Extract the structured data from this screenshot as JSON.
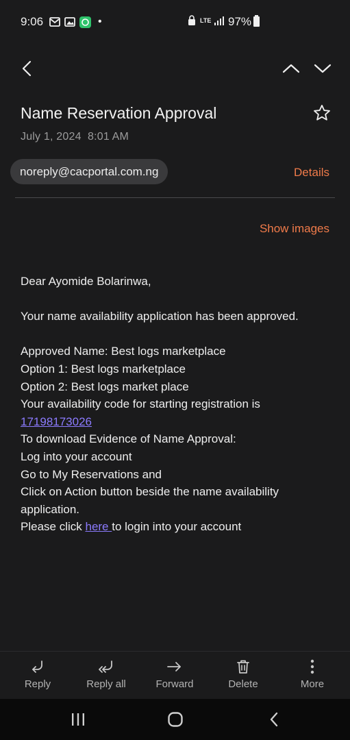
{
  "status_bar": {
    "time": "9:06",
    "battery": "97%",
    "network": "LTE",
    "dot": "•"
  },
  "email": {
    "subject": "Name Reservation Approval",
    "date": "July 1, 2024  8:01 AM",
    "sender": "noreply@cacportal.com.ng",
    "details_label": "Details",
    "show_images_label": "Show images"
  },
  "body": {
    "greeting": "Dear Ayomide Bolarinwa,",
    "approved_line": "Your name availability application has been approved.",
    "approved_name": "Approved Name: Best logs marketplace",
    "option1": "Option 1: Best logs marketplace",
    "option2": "Option 2: Best logs market place",
    "code_intro": "Your availability code for starting registration is",
    "code": "17198173026",
    "download_intro": "To download Evidence of Name Approval:",
    "step1": "Log into your account",
    "step2": "Go to My Reservations and",
    "step3a": "Click on Action button beside the name availability",
    "step3b": "application.",
    "click_prefix": "Please click ",
    "click_link": "here ",
    "click_suffix": "to login into your account"
  },
  "actions": {
    "reply": "Reply",
    "reply_all": "Reply all",
    "forward": "Forward",
    "delete": "Delete",
    "more": "More"
  },
  "colors": {
    "background": "#1b1b1c",
    "accent": "#f07b4a",
    "link": "#8c7bff"
  }
}
